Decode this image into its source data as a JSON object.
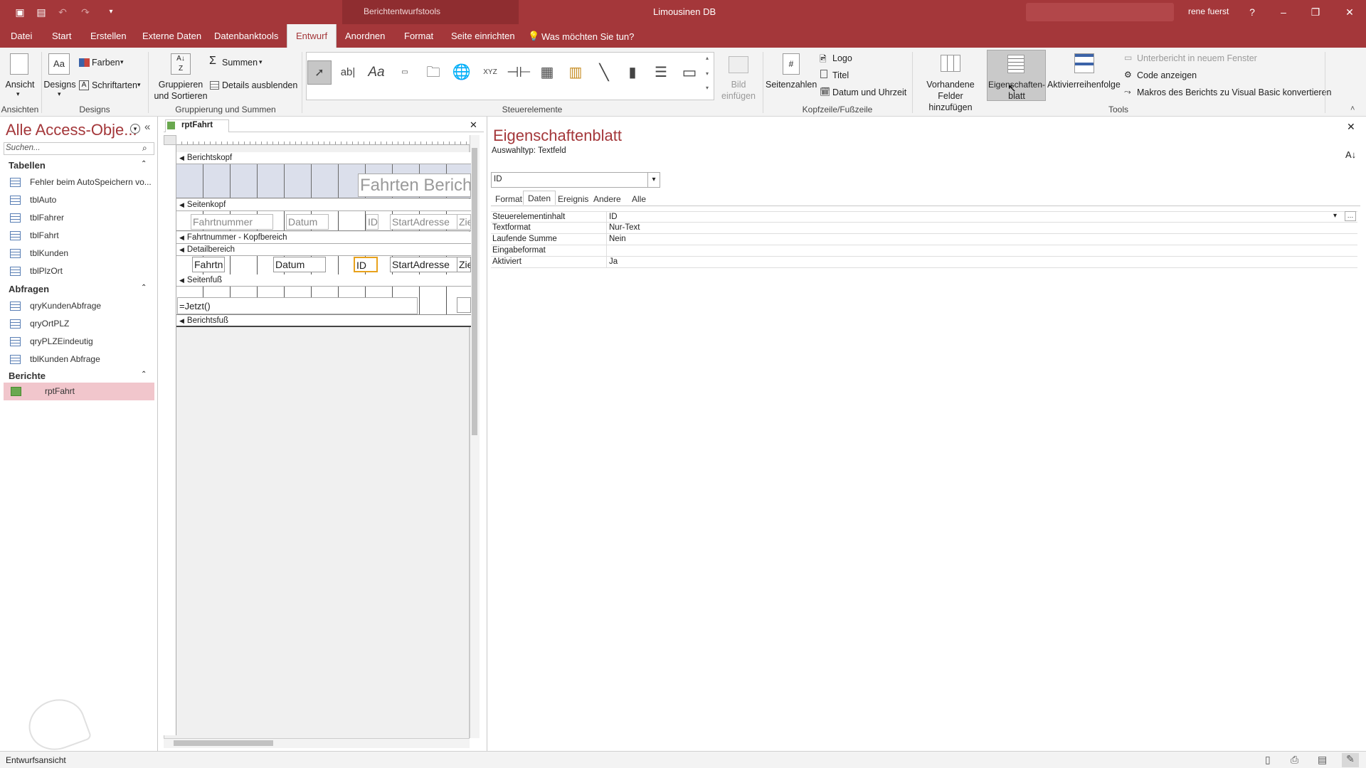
{
  "window": {
    "context_tool": "Berichtentwurfstools",
    "app_title": "Limousinen DB",
    "user": "rene fuerst",
    "help": "?"
  },
  "ribbon_tabs": [
    "Datei",
    "Start",
    "Erstellen",
    "Externe Daten",
    "Datenbanktools",
    "Entwurf",
    "Anordnen",
    "Format",
    "Seite einrichten"
  ],
  "tell_me": "Was möchten Sie tun?",
  "ribbon": {
    "ansicht": "Ansicht",
    "designs": "Designs",
    "farben": "Farben",
    "schriftarten": "Schriftarten",
    "gruppieren_1": "Gruppieren",
    "gruppieren_2": "und Sortieren",
    "summen": "Summen",
    "details": "Details ausblenden",
    "bild_1": "Bild",
    "bild_2": "einfügen",
    "seitenzahlen": "Seitenzahlen",
    "logo": "Logo",
    "titel": "Titel",
    "datum_uhrzeit": "Datum und Uhrzeit",
    "vorhandene_1": "Vorhandene",
    "vorhandene_2": "Felder hinzufügen",
    "eigenschaften_1": "Eigenschaften-",
    "eigenschaften_2": "blatt",
    "aktivierreihenfolge": "Aktivierreihenfolge",
    "unterbericht": "Unterbericht in neuem Fenster",
    "code": "Code anzeigen",
    "makros": "Makros des Berichts zu Visual Basic konvertieren",
    "groups": {
      "ansichten": "Ansichten",
      "designs": "Designs",
      "gruppierung": "Gruppierung und Summen",
      "steuerelemente": "Steuerelemente",
      "kopfzeile": "Kopfzeile/Fußzeile",
      "tools": "Tools"
    }
  },
  "nav": {
    "title": "Alle Access-Obje...",
    "search_placeholder": "Suchen...",
    "groups": [
      {
        "name": "Tabellen",
        "items": [
          "Fehler beim AutoSpeichern vo...",
          "tblAuto",
          "tblFahrer",
          "tblFahrt",
          "tblKunden",
          "tblPlzOrt"
        ]
      },
      {
        "name": "Abfragen",
        "items": [
          "qryKundenAbfrage",
          "qryOrtPLZ",
          "qryPLZEindeutig",
          "tblKunden Abfrage"
        ]
      },
      {
        "name": "Berichte",
        "items": [
          "rptFahrt"
        ]
      }
    ]
  },
  "report": {
    "tab": "rptFahrt",
    "sections": [
      "Berichtskopf",
      "Seitenkopf",
      "Fahrtnummer - Kopfbereich",
      "Detailbereich",
      "Seitenfuß",
      "Berichtsfuß"
    ],
    "title_label": "Fahrten Berich",
    "header_labels": [
      "Fahrtnummer",
      "Datum",
      "ID",
      "StartAdresse",
      "Zie"
    ],
    "detail_fields": [
      "Fahrtn",
      "Datum",
      "ID",
      "StartAdresse",
      "Zie"
    ],
    "footer_expr": "=Jetzt()"
  },
  "props": {
    "title": "Eigenschaftenblatt",
    "selection_type": "Auswahltyp:  Textfeld",
    "selected": "ID",
    "tabs": [
      "Format",
      "Daten",
      "Ereignis",
      "Andere",
      "Alle"
    ],
    "active_tab": "Daten",
    "rows": [
      {
        "k": "Steuerelementinhalt",
        "v": "ID"
      },
      {
        "k": "Textformat",
        "v": "Nur-Text"
      },
      {
        "k": "Laufende Summe",
        "v": "Nein"
      },
      {
        "k": "Eingabeformat",
        "v": ""
      },
      {
        "k": "Aktiviert",
        "v": "Ja"
      }
    ]
  },
  "status": "Entwurfsansicht"
}
